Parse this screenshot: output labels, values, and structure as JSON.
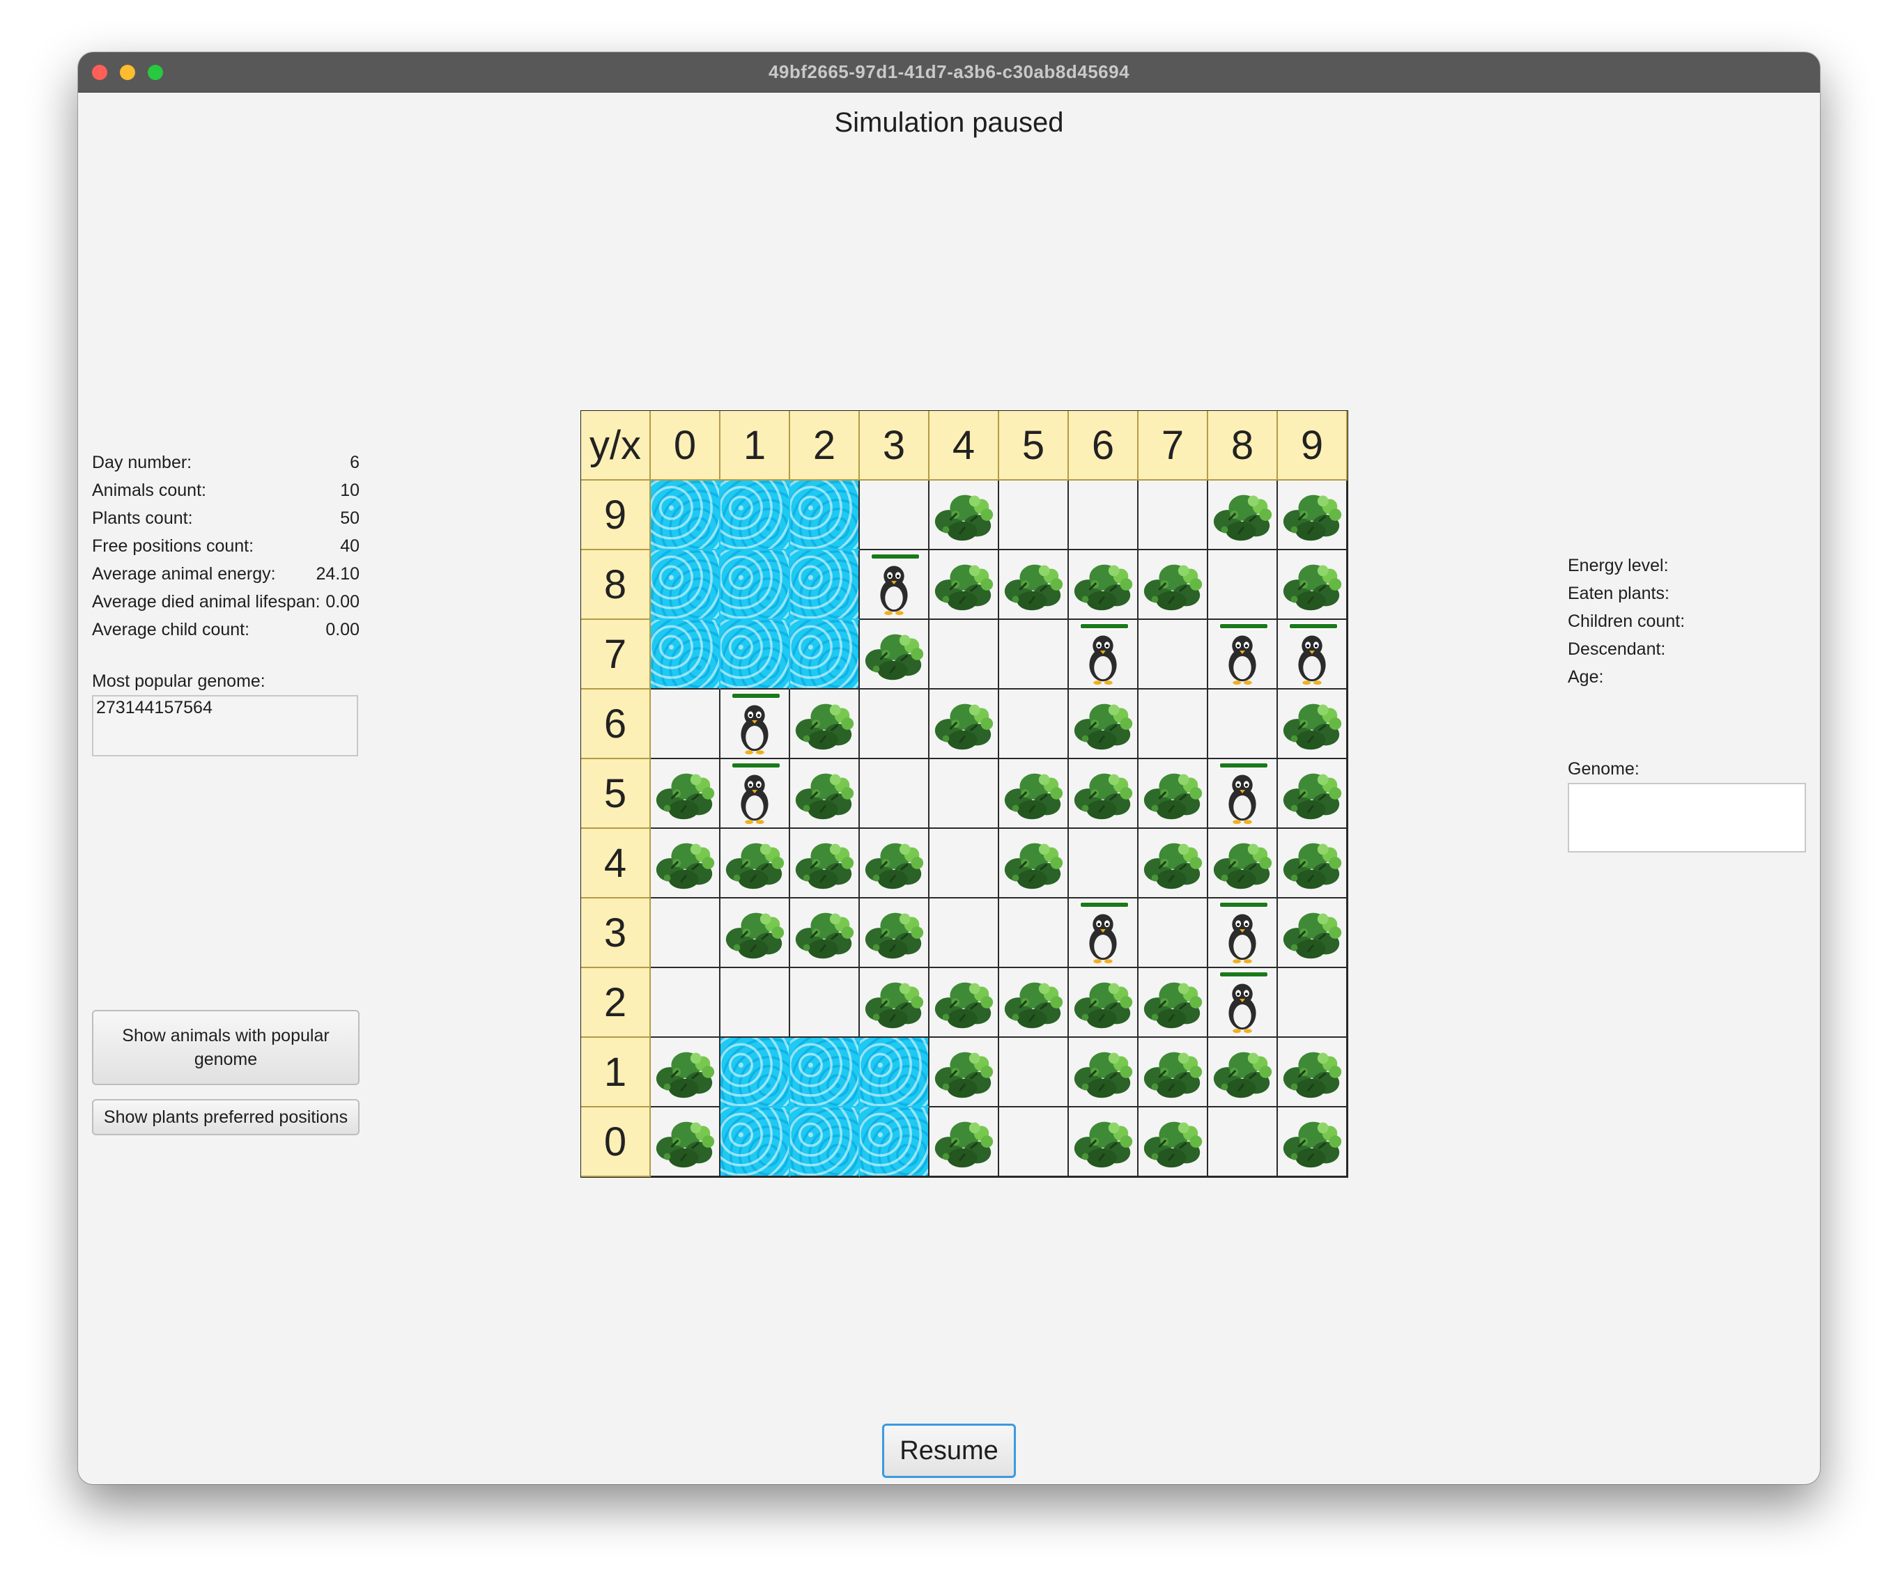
{
  "window": {
    "title": "49bf2665-97d1-41d7-a3b6-c30ab8d45694"
  },
  "status": "Simulation paused",
  "stats": [
    {
      "label": "Day number:",
      "value": "6"
    },
    {
      "label": "Animals count:",
      "value": "10"
    },
    {
      "label": "Plants count:",
      "value": "50"
    },
    {
      "label": "Free positions count:",
      "value": "40"
    },
    {
      "label": "Average animal energy:",
      "value": "24.10"
    },
    {
      "label": "Average died animal lifespan:",
      "value": "0.00"
    },
    {
      "label": "Average child count:",
      "value": "0.00"
    }
  ],
  "genome": {
    "label": "Most popular genome:",
    "value": "273144157564"
  },
  "buttons": {
    "popular": "Show animals with popular genome",
    "plants": "Show plants preferred positions",
    "resume": "Resume"
  },
  "grid": {
    "corner": "y/x",
    "x_labels": [
      "0",
      "1",
      "2",
      "3",
      "4",
      "5",
      "6",
      "7",
      "8",
      "9"
    ],
    "rows": [
      {
        "y": "9",
        "cells": [
          "W",
          "W",
          "W",
          "E",
          "P",
          "E",
          "E",
          "E",
          "P",
          "P"
        ]
      },
      {
        "y": "8",
        "cells": [
          "W",
          "W",
          "W",
          "A",
          "P",
          "P",
          "P",
          "P",
          "E",
          "P"
        ]
      },
      {
        "y": "7",
        "cells": [
          "W",
          "W",
          "W",
          "P",
          "E",
          "E",
          "A",
          "E",
          "A",
          "A"
        ]
      },
      {
        "y": "6",
        "cells": [
          "E",
          "A",
          "P",
          "E",
          "P",
          "E",
          "P",
          "E",
          "E",
          "P"
        ]
      },
      {
        "y": "5",
        "cells": [
          "P",
          "A",
          "P",
          "E",
          "E",
          "P",
          "P",
          "P",
          "A",
          "P"
        ]
      },
      {
        "y": "4",
        "cells": [
          "P",
          "P",
          "P",
          "P",
          "E",
          "P",
          "E",
          "P",
          "P",
          "P"
        ]
      },
      {
        "y": "3",
        "cells": [
          "E",
          "P",
          "P",
          "P",
          "E",
          "E",
          "A",
          "E",
          "A",
          "P"
        ]
      },
      {
        "y": "2",
        "cells": [
          "E",
          "E",
          "E",
          "P",
          "P",
          "P",
          "P",
          "P",
          "A",
          "E"
        ]
      },
      {
        "y": "1",
        "cells": [
          "P",
          "W",
          "W",
          "W",
          "P",
          "E",
          "P",
          "P",
          "P",
          "P"
        ]
      },
      {
        "y": "0",
        "cells": [
          "P",
          "W",
          "W",
          "W",
          "P",
          "E",
          "P",
          "P",
          "E",
          "P"
        ]
      }
    ],
    "legend": {
      "W": "water-tile",
      "P": "plant-icon",
      "A": "penguin-icon",
      "E": "empty"
    }
  },
  "animal_info": {
    "labels": [
      "Energy level:",
      "Eaten plants:",
      "Children count:",
      "Descendant:",
      "Age:"
    ],
    "genome_label": "Genome:"
  }
}
